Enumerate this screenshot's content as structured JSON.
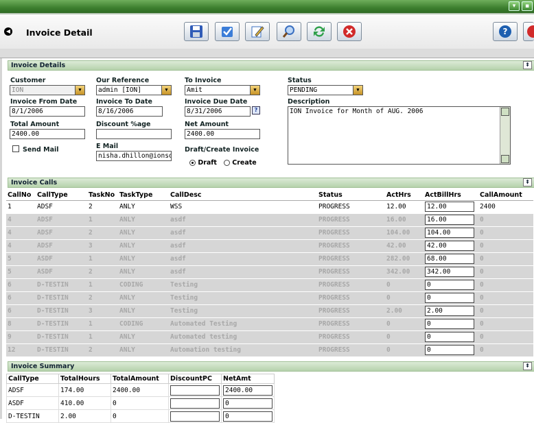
{
  "window": {
    "minimize_glyph": "▾",
    "close_glyph": "▪"
  },
  "toolbar": {
    "title": "Invoice Detail",
    "buttons": [
      {
        "name": "save-icon",
        "color": "#2f5bb7"
      },
      {
        "name": "approve-icon",
        "color": "#3b7dd8"
      },
      {
        "name": "edit-icon",
        "color": "#4a8a3a"
      },
      {
        "name": "search-icon",
        "color": "#3a6fc0"
      },
      {
        "name": "refresh-icon",
        "color": "#2fa04a"
      },
      {
        "name": "cancel-icon",
        "color": "#d12a2a"
      },
      {
        "name": "help-icon",
        "color": "#1e5fb0"
      }
    ]
  },
  "details": {
    "header": "Invoice Details",
    "customer_label": "Customer",
    "customer_value": "ION",
    "our_ref_label": "Our Reference",
    "our_ref_value": "admin [ION]",
    "to_invoice_label": "To Invoice",
    "to_invoice_value": "Amit",
    "status_label": "Status",
    "status_value": "PENDING",
    "from_date_label": "Invoice From Date",
    "from_date_value": "8/1/2006",
    "to_date_label": "Invoice To Date",
    "to_date_value": "8/16/2006",
    "due_date_label": "Invoice Due Date",
    "due_date_value": "8/31/2006",
    "help_glyph": "?",
    "description_label": "Description",
    "description_value": "ION Invoice for Month of  AUG. 2006",
    "total_label": "Total Amount",
    "total_value": "2400.00",
    "discount_label": "Discount %age",
    "discount_value": "",
    "net_label": "Net Amount",
    "net_value": "2400.00",
    "send_mail_label": "Send Mail",
    "email_label": "E Mail",
    "email_value": "nisha.dhillon@ionsoft",
    "draft_create_label": "Draft/Create Invoice",
    "draft_label": "Draft",
    "create_label": "Create"
  },
  "calls": {
    "header": "Invoice Calls",
    "columns": [
      "CallNo",
      "CallType",
      "TaskNo",
      "TaskType",
      "CallDesc",
      "Status",
      "ActHrs",
      "ActBillHrs",
      "CallAmount"
    ],
    "rows": [
      {
        "active": true,
        "cells": [
          "1",
          "ADSF",
          "2",
          "ANLY",
          "WSS",
          "PROGRESS",
          "12.00",
          "12.00",
          "2400"
        ]
      },
      {
        "active": false,
        "cells": [
          "4",
          "ADSF",
          "1",
          "ANLY",
          "asdf",
          "PROGRESS",
          "16.00",
          "16.00",
          "0"
        ]
      },
      {
        "active": false,
        "cells": [
          "4",
          "ADSF",
          "2",
          "ANLY",
          "asdf",
          "PROGRESS",
          "104.00",
          "104.00",
          "0"
        ]
      },
      {
        "active": false,
        "cells": [
          "4",
          "ADSF",
          "3",
          "ANLY",
          "asdf",
          "PROGRESS",
          "42.00",
          "42.00",
          "0"
        ]
      },
      {
        "active": false,
        "cells": [
          "5",
          "ASDF",
          "1",
          "ANLY",
          "asdf",
          "PROGRESS",
          "282.00",
          "68.00",
          "0"
        ]
      },
      {
        "active": false,
        "cells": [
          "5",
          "ASDF",
          "2",
          "ANLY",
          "asdf",
          "PROGRESS",
          "342.00",
          "342.00",
          "0"
        ]
      },
      {
        "active": false,
        "cells": [
          "6",
          "D-TESTIN",
          "1",
          "CODING",
          "Testing",
          "PROGRESS",
          "0",
          "0",
          "0"
        ]
      },
      {
        "active": false,
        "cells": [
          "6",
          "D-TESTIN",
          "2",
          "ANLY",
          "Testing",
          "PROGRESS",
          "0",
          "0",
          "0"
        ]
      },
      {
        "active": false,
        "cells": [
          "6",
          "D-TESTIN",
          "3",
          "ANLY",
          "Testing",
          "PROGRESS",
          "2.00",
          "2.00",
          "0"
        ]
      },
      {
        "active": false,
        "cells": [
          "8",
          "D-TESTIN",
          "1",
          "CODING",
          "Automated Testing",
          "PROGRESS",
          "0",
          "0",
          "0"
        ]
      },
      {
        "active": false,
        "cells": [
          "9",
          "D-TESTIN",
          "1",
          "ANLY",
          "Automated testing",
          "PROGRESS",
          "0",
          "0",
          "0"
        ]
      },
      {
        "active": false,
        "cells": [
          "12",
          "D-TESTIN",
          "2",
          "ANLY",
          "Automation testing",
          "PROGRESS",
          "0",
          "0",
          "0"
        ]
      }
    ]
  },
  "summary": {
    "header": "Invoice Summary",
    "columns": [
      "CallType",
      "TotalHours",
      "TotalAmount",
      "DiscountPC",
      "NetAmt"
    ],
    "rows": [
      [
        "ADSF",
        "174.00",
        "2400.00",
        "",
        "2400.00"
      ],
      [
        "ASDF",
        "410.00",
        "0",
        "",
        "0"
      ],
      [
        "D-TESTIN",
        "2.00",
        "0",
        "",
        "0"
      ]
    ]
  },
  "collapse_glyph": "⇞"
}
